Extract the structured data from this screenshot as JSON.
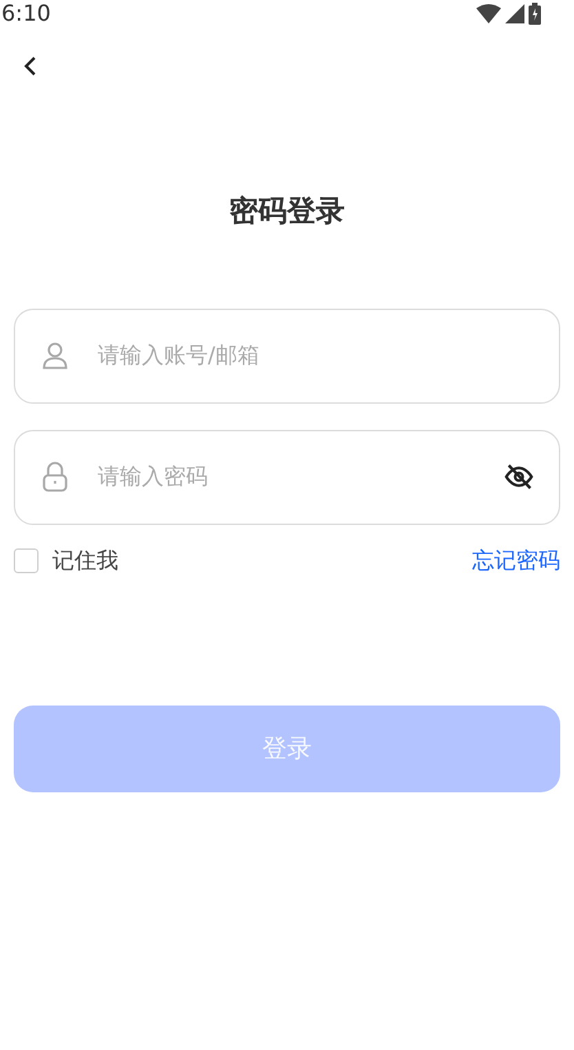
{
  "status_bar": {
    "time": "6:10"
  },
  "title": "密码登录",
  "account_field": {
    "placeholder": "请输入账号/邮箱"
  },
  "password_field": {
    "placeholder": "请输入密码",
    "visible": false
  },
  "remember_me": {
    "label": "记住我",
    "checked": false
  },
  "forgot_password": "忘记密码",
  "login_button": {
    "label": "登录",
    "disabled": true
  }
}
